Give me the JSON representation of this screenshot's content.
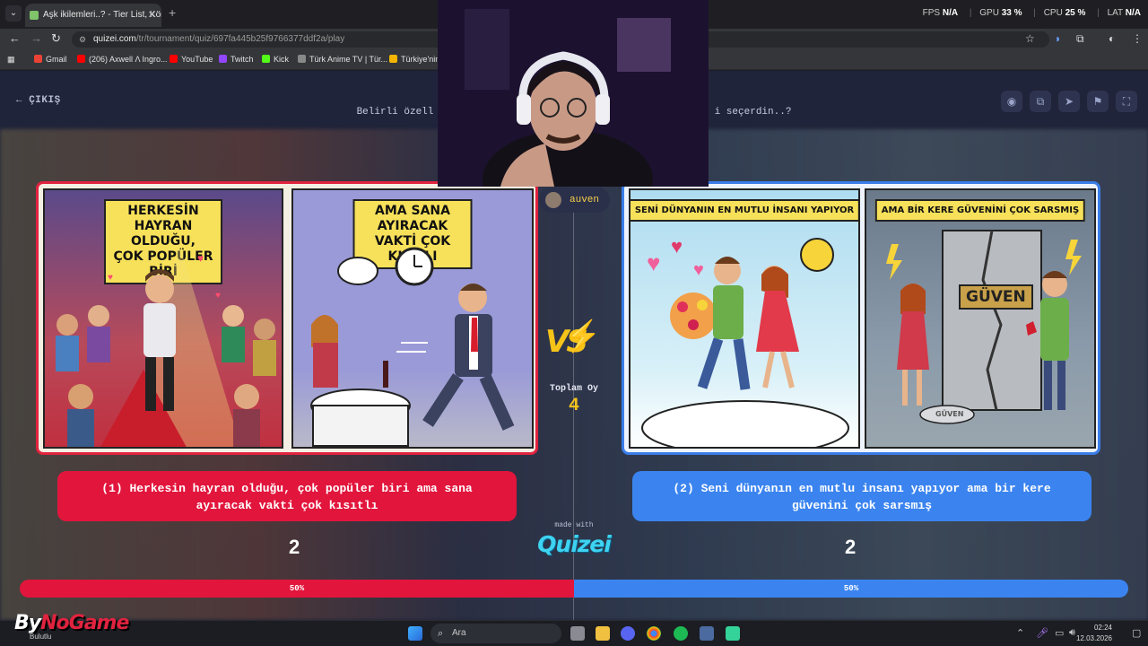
{
  "browser": {
    "tab_title": "Aşk ikilemleri..? - Tier List, Kör S",
    "url_domain": "quizei.com",
    "url_path": "/tr/tournament/quiz/697fa445b25f9766377ddf2a/play",
    "perf": {
      "fps_label": "FPS",
      "fps": "N/A",
      "gpu_label": "GPU",
      "gpu": "33 %",
      "cpu_label": "CPU",
      "cpu": "25 %",
      "lat_label": "LAT",
      "lat": "N/A"
    },
    "bookmarks": [
      {
        "label": "Gmail",
        "color": "#ea4335"
      },
      {
        "label": "(206) Axwell Λ Ingro...",
        "color": "#ff0000"
      },
      {
        "label": "YouTube",
        "color": "#ff0000"
      },
      {
        "label": "Twitch",
        "color": "#9146ff"
      },
      {
        "label": "Kick",
        "color": "#53fc18"
      },
      {
        "label": "Türk Anime TV | Tür...",
        "color": "#888888"
      },
      {
        "label": "Türkiye'nin",
        "color": "#f5b400"
      }
    ]
  },
  "quiz": {
    "exit_label": "ÇIKIŞ",
    "question_left": "Belirli özell",
    "question_right": "i seçerdin..?",
    "left": {
      "caption_a": "HERKESİN HAYRAN OLDUĞU,\nÇOK POPÜLER BİRİ",
      "caption_b": "AMA SANA AYIRACAK\nVAKTİ ÇOK KISITLI",
      "option_text": "(1) Herkesin hayran olduğu, çok popüler biri ama sana ayıracak vakti çok kısıtlı",
      "votes": "2",
      "percent": "50%",
      "color": "#e2153c"
    },
    "right": {
      "caption_a": "SENİ DÜNYANIN EN MUTLU İNSANI YAPIYOR",
      "caption_b": "AMA BİR KERE GÜVENİNİ ÇOK SARSMIŞ",
      "sign_text": "GÜVEN",
      "broken_text": "GÜVEN",
      "option_text": "(2) Seni dünyanın en mutlu insanı yapıyor ama bir kere güvenini çok sarsmış",
      "votes": "2",
      "percent": "50%",
      "color": "#3b84f0"
    },
    "vs_label": "VS",
    "total_label": "Toplam Oy",
    "total_votes": "4",
    "made_with": "made with",
    "logo": "Quizei",
    "user_name": "auven"
  },
  "taskbar": {
    "search_placeholder": "Ara",
    "weather": "Bulutlu",
    "brand_a": "By",
    "brand_b": "NoGame",
    "time": "02:24",
    "date": "12.03.2026"
  }
}
